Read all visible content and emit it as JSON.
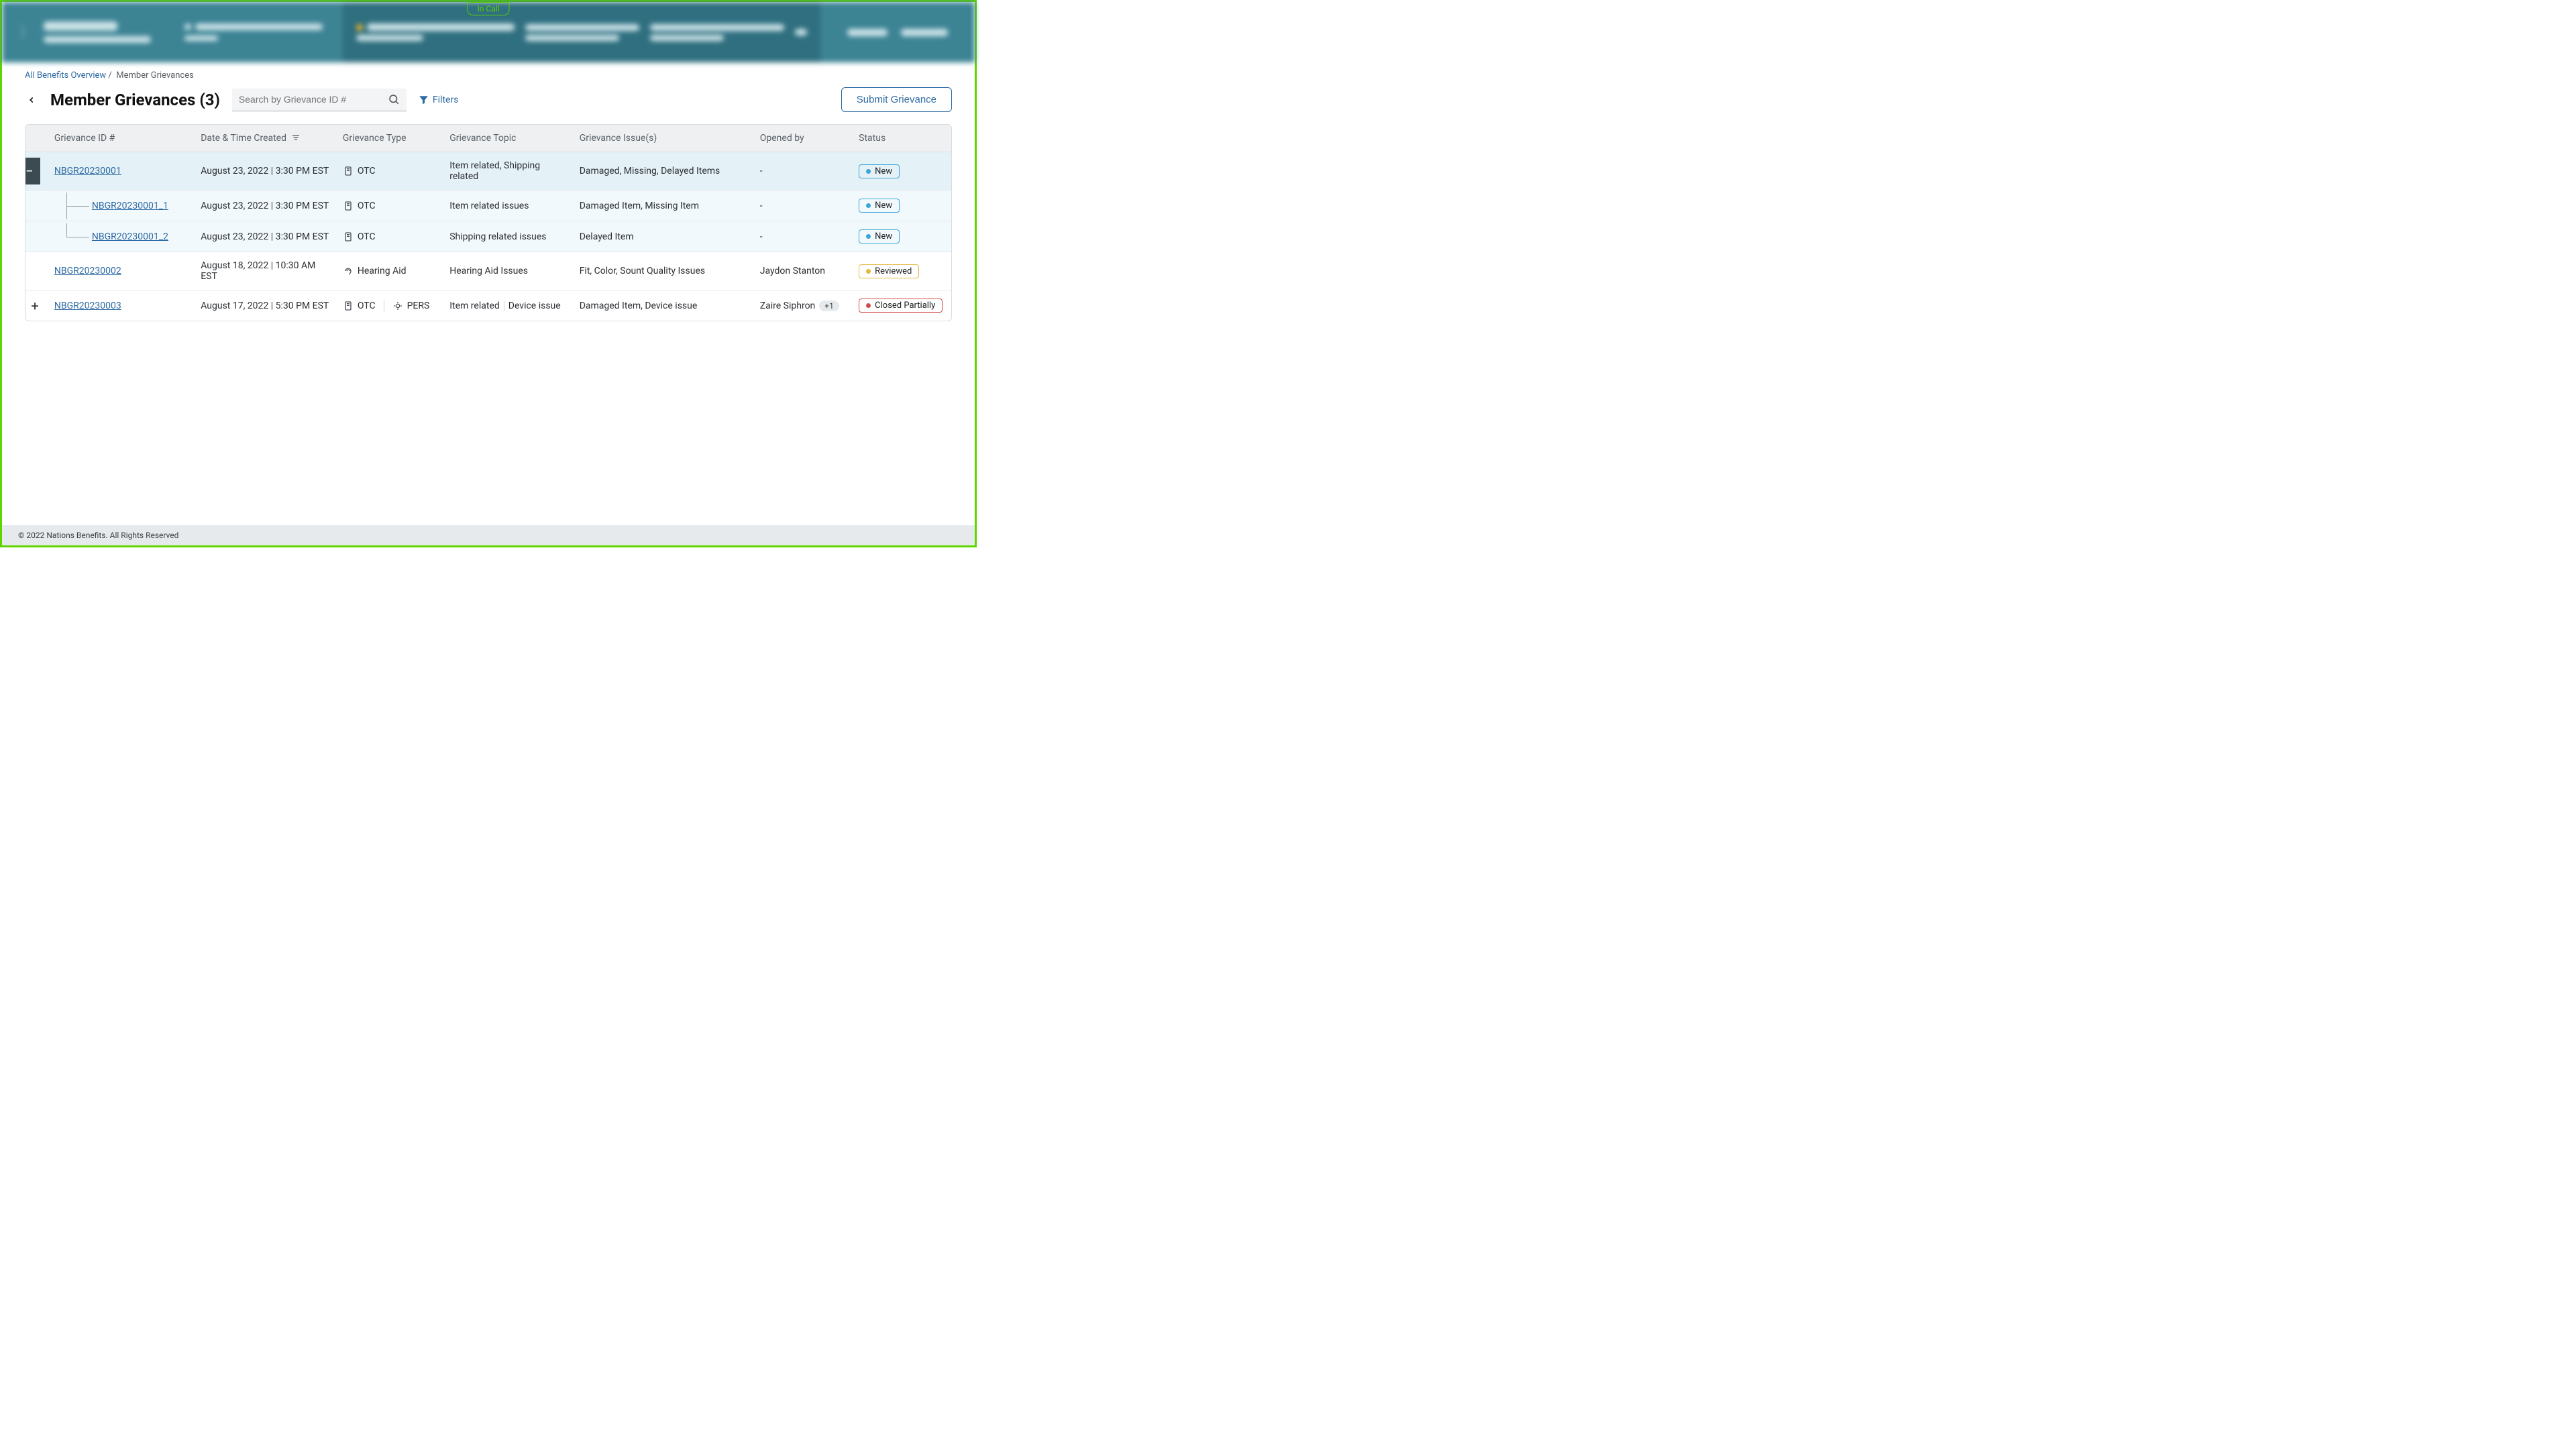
{
  "in_call_label": "In Call",
  "breadcrumb": {
    "root": "All Benefits Overview",
    "current": "Member Grievances"
  },
  "page_title": "Member Grievances (3)",
  "search_placeholder": "Search by Grievance ID #",
  "filters_label": "Filters",
  "submit_label": "Submit Grievance",
  "columns": {
    "id": "Grievance ID #",
    "date": "Date & Time Created",
    "type": "Grievance Type",
    "topic": "Grievance Topic",
    "issue": "Grievance Issue(s)",
    "opened": "Opened by",
    "status": "Status"
  },
  "rows": [
    {
      "kind": "parent-expanded",
      "id": "NBGR20230001",
      "date": "August 23, 2022 | 3:30 PM EST",
      "types": [
        "OTC"
      ],
      "topic": "Item related, Shipping related",
      "issue": "Damaged, Missing, Delayed Items",
      "opened": "-",
      "status": "New"
    },
    {
      "kind": "child",
      "tree": "cont",
      "id": "NBGR20230001_1",
      "date": "August 23, 2022 | 3:30 PM EST",
      "types": [
        "OTC"
      ],
      "topic": "Item related issues",
      "issue": "Damaged Item, Missing Item",
      "opened": "-",
      "status": "New"
    },
    {
      "kind": "child",
      "tree": "last",
      "id": "NBGR20230001_2",
      "date": "August 23, 2022 | 3:30 PM EST",
      "types": [
        "OTC"
      ],
      "topic": "Shipping related issues",
      "issue": "Delayed Item",
      "opened": "-",
      "status": "New"
    },
    {
      "kind": "leaf",
      "id": "NBGR20230002",
      "date": "August 18, 2022 | 10:30 AM EST",
      "types": [
        "Hearing Aid"
      ],
      "topic": "Hearing Aid Issues",
      "issue": "Fit, Color, Sount Quality Issues",
      "opened": "Jaydon Stanton",
      "status": "Reviewed"
    },
    {
      "kind": "parent-collapsed",
      "id": "NBGR20230003",
      "date": "August 17, 2022 | 5:30 PM EST",
      "types": [
        "OTC",
        "PERS"
      ],
      "topic_parts": [
        "Item related",
        "Device issue"
      ],
      "issue": "Damaged Item, Device issue",
      "opened": "Zaire Siphron",
      "opened_more": "+1",
      "status": "Closed Partially"
    }
  ],
  "footer": "© 2022 Nations Benefits. All Rights Reserved"
}
